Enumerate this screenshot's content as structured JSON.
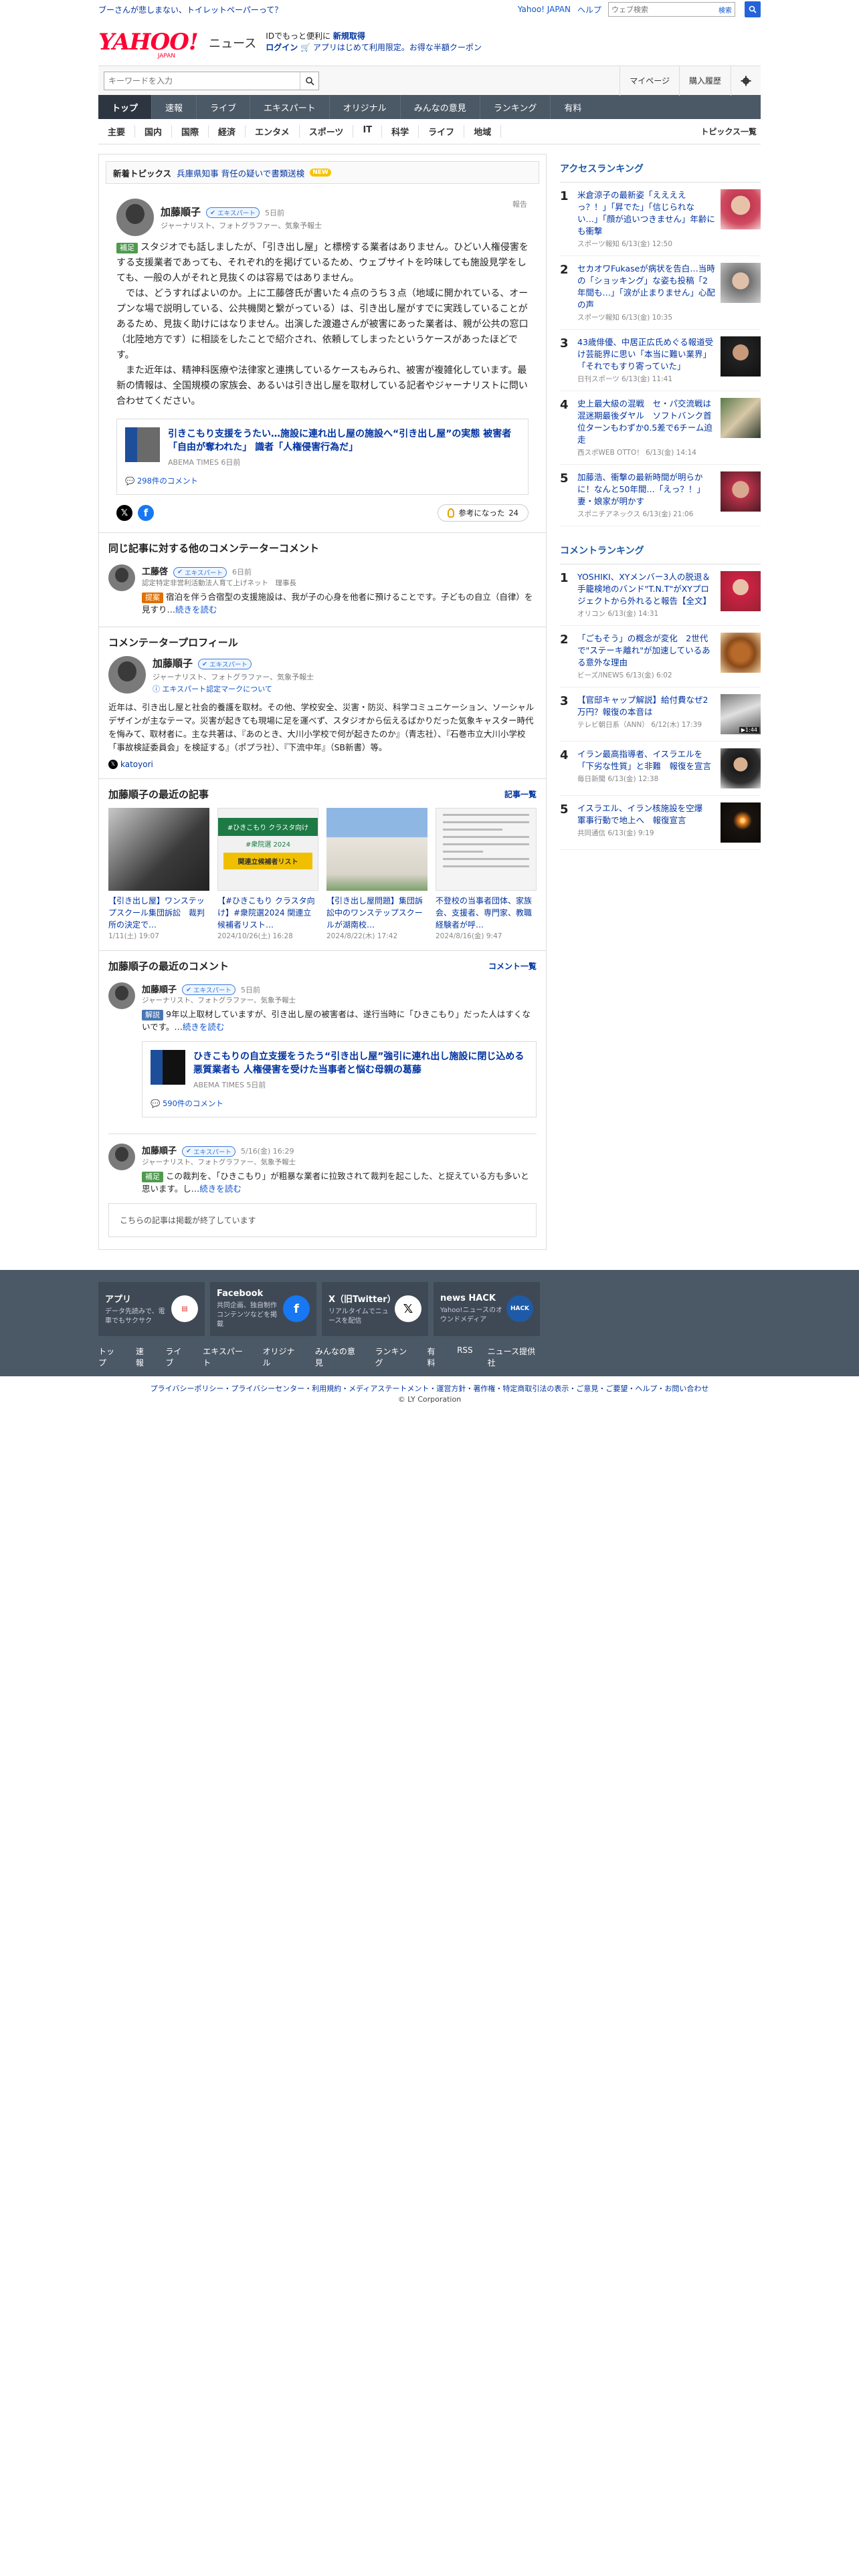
{
  "topbar": {
    "promo": "ブーさんが悲しまない、トイレットペーパーって？",
    "links": [
      "Yahoo! JAPAN",
      "ヘルプ"
    ],
    "search_placeholder": "ウェブ検索",
    "search_button": "検索"
  },
  "header": {
    "logo_main": "YAHOO!",
    "logo_sub": "JAPAN",
    "logo_service": "ニュース",
    "login_line1_prefix": "IDでもっと便利に",
    "login_line1_link": "新規取得",
    "login_line2_link": "ログイン",
    "login_line2_rest": "アプリはじめて利用限定。お得な半額クーポン"
  },
  "search": {
    "placeholder": "キーワードを入力",
    "mypage": "マイページ",
    "history": "購入履歴"
  },
  "mainnav": [
    "トップ",
    "速報",
    "ライブ",
    "エキスパート",
    "オリジナル",
    "みんなの意見",
    "ランキング",
    "有料"
  ],
  "subnav": {
    "items": [
      "主要",
      "国内",
      "国際",
      "経済",
      "エンタメ",
      "スポーツ",
      "IT",
      "科学",
      "ライフ",
      "地域"
    ],
    "topics_list": "トピックス一覧"
  },
  "breaking": {
    "label": "新着トピックス",
    "text": "兵庫県知事 背任の疑いで書類送検",
    "badge": "NEW"
  },
  "main_comment": {
    "name": "加藤順子",
    "badge": "エキスパート",
    "time": "5日前",
    "job": "ジャーナリスト、フォトグラファー、気象予報士",
    "report": "報告",
    "tag": "補足",
    "p1": "スタジオでも話しましたが、「引き出し屋」と標榜する業者はありません。ひどい人権侵害をする支援業者であっても、それぞれ的を掲げているため、ウェブサイトを吟味しても施設見学をしても、一般の人がそれと見抜くのは容易ではありません。",
    "p2": "では、どうすればよいのか。上に工藤啓氏が書いた４点のうち３点（地域に開かれている、オープンな場で説明している、公共機関と繋がっている）は、引き出し屋がすでに実践していることがあるため、見抜く助けにはなりません。出演した渡邉さんが被害にあった業者は、親が公共の窓口（北陸地方です）に相談をしたことで紹介され、依頼してしまったというケースがあったほどです。",
    "p3": "また近年は、精神科医療や法律家と連携しているケースもみられ、被害が複雑化しています。最新の情報は、全国規模の家族会、あるいは引き出し屋を取材している記者やジャーナリストに問い合わせてください。",
    "link_title": "引きこもり支援をうたい…施設に連れ出し屋の施設へ“引き出し屋”の実態 被害者「自由が奪われた」 識者「人権侵害行為だ」",
    "link_source": "ABEMA TIMES 6日前",
    "link_comments": "298件のコメント",
    "helpful_label": "参考になった",
    "helpful_count": "24"
  },
  "other_comments": {
    "title": "同じ記事に対する他のコメンテーターコメント",
    "items": [
      {
        "name": "工藤啓",
        "badge": "エキスパート",
        "time": "6日前",
        "job": "認定特定非営利活動法人育て上げネット　理事長",
        "tag": "提案",
        "text": "宿泊を伴う合宿型の支援施設は、我が子の心身を他者に預けることです。子どもの自立（自律）を見すり…",
        "more": "続きを読む"
      }
    ]
  },
  "profile": {
    "title": "コメンテータープロフィール",
    "name": "加藤順子",
    "badge": "エキスパート",
    "job": "ジャーナリスト、フォトグラファー、気象予報士",
    "about_link": "エキスパート認定マークについて",
    "text": "近年は、引き出し屋と社会的養護を取材。その他、学校安全、災害・防災、科学コミュニケーション、ソーシャルデザインが主なテーマ。災害が起きても現場に足を運べず、スタジオから伝えるばかりだった気象キャスター時代を悔みて、取材者に。主な共著は、『あのとき、大川小学校で何が起きたのか』（青志社）、『石巻市立大川小学校「事故検証委員会」を検証する』（ポプラ社）、『下流中年』（SB新書）等。",
    "x_handle": "katoyori"
  },
  "recent_articles": {
    "title": "加藤順子の最近の記事",
    "more": "記事一覧",
    "items": [
      {
        "title": "【引き出し屋】ワンステップスクール集団訴訟　裁判所の決定で…",
        "date": "1/11(土) 19:07"
      },
      {
        "title": "【#ひきこもり クラスタ向け】#衆院選2024 関連立候補者リスト…",
        "date": "2024/10/26(土) 16:28"
      },
      {
        "title": "【引き出し屋問題】集団訴訟中のワンステップスクールが湖南校…",
        "date": "2024/8/22(木) 17:42"
      },
      {
        "title": "不登校の当事者団体、家族会、支援者、専門家、教職経験者が呼…",
        "date": "2024/8/16(金) 9:47"
      }
    ],
    "art2_head": "#ひきこもり クラスタ向け",
    "art2_sub": "#衆院選 2024",
    "art2_banner": "関連立候補者リスト"
  },
  "recent_comments": {
    "title": "加藤順子の最近のコメント",
    "more": "コメント一覧",
    "items": [
      {
        "name": "加藤順子",
        "badge": "エキスパート",
        "time": "5日前",
        "job": "ジャーナリスト、フォトグラファー、気象予報士",
        "tag": "解説",
        "text": "9年以上取材していますが、引き出し屋の被害者は、遂行当時に「ひきこもり」だった人はすくないです。…",
        "more": "続きを読む",
        "link_title": "ひきこもりの自立支援をうたう“引き出し屋”強引に連れ出し施設に閉じ込める悪質業者も 人権侵害を受けた当事者と悩む母親の葛藤",
        "link_source": "ABEMA TIMES 5日前",
        "link_comments": "590件のコメント"
      },
      {
        "name": "加藤順子",
        "badge": "エキスパート",
        "time": "5/16(金) 16:29",
        "job": "ジャーナリスト、フォトグラファー、気象予報士",
        "tag": "補足",
        "text": "この裁判を、「ひきこもり」が粗暴な業者に拉致されて裁判を起こした、と捉えている方も多いと思います。し…",
        "more": "続きを読む"
      }
    ],
    "closed": "こちらの記事は掲載が終了しています"
  },
  "access_ranking": {
    "title": "アクセスランキング",
    "items": [
      {
        "n": "1",
        "title": "米倉涼子の最新姿「ええええっ？！」「昇でた」「信じられない…」「顔が追いつきません」年齢にも衝撃",
        "src": "スポーツ報知 6/13(金) 12:50"
      },
      {
        "n": "2",
        "title": "セカオワFukaseが病状を告白…当時の「ショッキング」な姿も投稿「2年間も…」「涙が止まりません」心配の声",
        "src": "スポーツ報知 6/13(金) 10:35"
      },
      {
        "n": "3",
        "title": "43歳俳優、中居正広氏めぐる報道受け芸能界に思い「本当に難い業界」「それでもすり寄っていた」",
        "src": "日刊スポーツ 6/13(金) 11:41"
      },
      {
        "n": "4",
        "title": "史上最大級の混戦　セ・パ交流戦は混迷期最後ダヤル　ソフトバンク首位ターンもわずか0.5差で6チーム迫走",
        "src": "西スポWEB OTTO！ 6/13(金) 14:14"
      },
      {
        "n": "5",
        "title": "加藤浩、衝撃の最新時間が明らかに！なんと50年間…「えっ？！」妻・娘家が明かす",
        "src": "スポニチアネックス 6/13(金) 21:06"
      }
    ]
  },
  "comment_ranking": {
    "title": "コメントランキング",
    "items": [
      {
        "n": "1",
        "title": "YOSHIKI、XYメンバー3人の脱退＆手籠検地のバンド\"T.N.T\"がXYプロジェクトから外れると報告【全文】",
        "src": "オリコン 6/13(金) 14:31"
      },
      {
        "n": "2",
        "title": "「ごもそう」の概念が変化　2世代で\"ステーキ離れ\"が加速しているある意外な理由",
        "src": "ビーズ/INEWS 6/13(金) 6:02"
      },
      {
        "n": "3",
        "title": "【官邸キャップ解説】給付費なぜ2万円？報復の本音は",
        "src": "テレビ朝日系（ANN） 6/12(木) 17:39",
        "badge": "▶1:44"
      },
      {
        "n": "4",
        "title": "イラン最高指導者、イスラエルを「下劣な性質」と非難　報復を宣言",
        "src": "毎日新聞 6/13(金) 12:38"
      },
      {
        "n": "5",
        "title": "イスラエル、イラン核施設を空爆　軍事行動で地上へ　報復宣言",
        "src": "共同通信 6/13(金) 9:19"
      }
    ]
  },
  "footer": {
    "apps": [
      {
        "title": "アプリ",
        "desc": "データ先読みで、電車でもサクサク",
        "icon": "news-app-icon"
      },
      {
        "title": "Facebook",
        "desc": "共同企画、独自制作コンテンツなどを掲載",
        "icon": "facebook-icon"
      },
      {
        "title": "X（旧Twitter）",
        "desc": "リアルタイムでニュースを配信",
        "icon": "x-icon"
      },
      {
        "title": "news HACK",
        "desc": "Yahoo!ニュースのオウンドメディア",
        "icon": "newshack-icon"
      }
    ],
    "nav": [
      "トップ",
      "速報",
      "ライブ",
      "エキスパート",
      "オリジナル",
      "みんなの意見",
      "ランキング",
      "有料",
      "RSS",
      "ニュース提供社"
    ],
    "legal": "プライバシーポリシー・プライバシーセンター・利用規約・メディアステートメント・運営方針・著作権・特定商取引法の表示・ご意見・ご要望・ヘルプ・お問い合わせ",
    "copyright": "© LY Corporation"
  }
}
